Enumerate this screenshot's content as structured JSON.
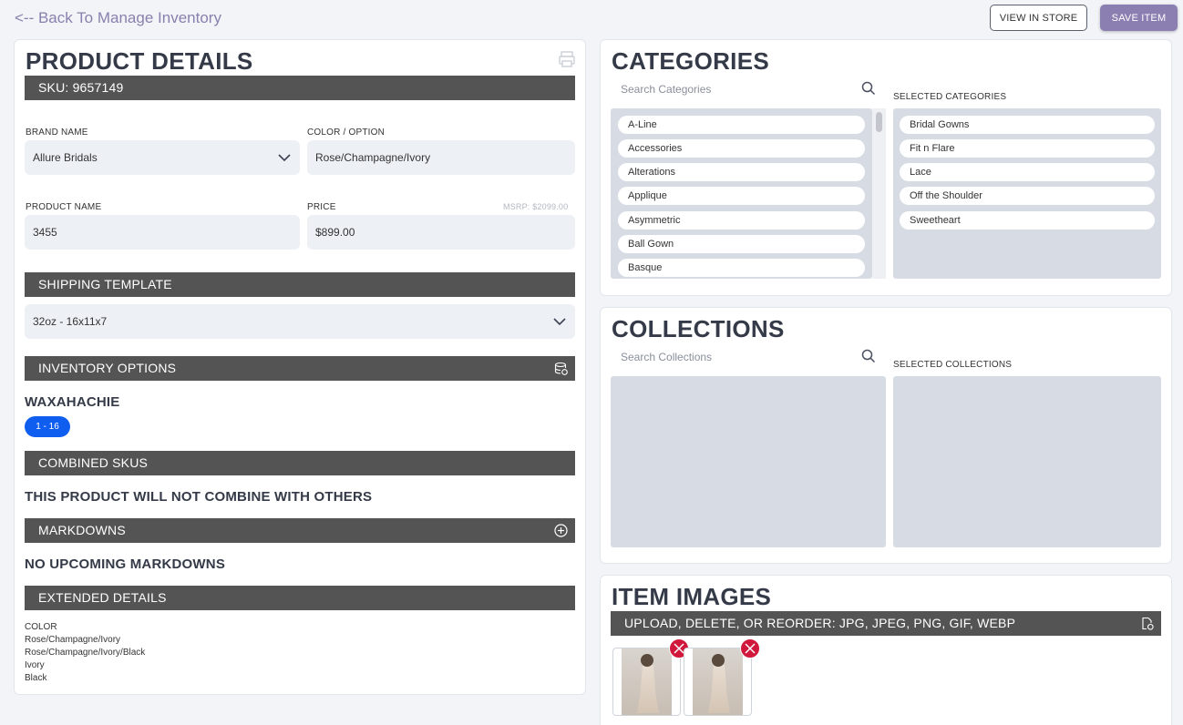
{
  "header": {
    "back_link": "<-- Back To Manage Inventory",
    "view_in_store": "VIEW IN STORE",
    "save_item": "SAVE ITEM"
  },
  "product_details": {
    "title": "PRODUCT DETAILS",
    "sku_bar": "SKU: 9657149",
    "brand_label": "BRAND NAME",
    "brand_value": "Allure Bridals",
    "color_label": "COLOR / OPTION",
    "color_value": "Rose/Champagne/Ivory",
    "product_name_label": "PRODUCT NAME",
    "product_name_value": "3455",
    "price_label": "PRICE",
    "msrp": "MSRP: $2099.00",
    "price_value": "$899.00",
    "shipping_bar": "SHIPPING TEMPLATE",
    "shipping_value": "32oz - 16x11x7",
    "inventory_bar": "INVENTORY OPTIONS",
    "location": "WAXAHACHIE",
    "size_badge": "1 - 16",
    "combined_bar": "COMBINED SKUS",
    "combined_text": "THIS PRODUCT WILL NOT COMBINE WITH OTHERS",
    "markdowns_bar": "MARKDOWNS",
    "markdowns_text": "NO UPCOMING MARKDOWNS",
    "extended_bar": "EXTENDED DETAILS",
    "extended_lines": [
      "COLOR",
      "Rose/Champagne/Ivory",
      "Rose/Champagne/Ivory/Black",
      "Ivory",
      "Black"
    ]
  },
  "categories": {
    "title": "CATEGORIES",
    "search_placeholder": "Search Categories",
    "available": [
      "A-Line",
      "Accessories",
      "Alterations",
      "Applique",
      "Asymmetric",
      "Ball Gown",
      "Basque"
    ],
    "selected_label": "SELECTED CATEGORIES",
    "selected": [
      "Bridal Gowns",
      "Fit n Flare",
      "Lace",
      "Off the Shoulder",
      "Sweetheart"
    ]
  },
  "collections": {
    "title": "COLLECTIONS",
    "search_placeholder": "Search Collections",
    "selected_label": "SELECTED COLLECTIONS"
  },
  "item_images": {
    "title": "ITEM IMAGES",
    "upload_bar": "UPLOAD, DELETE, OR REORDER: JPG, JPEG, PNG, GIF, WEBP"
  },
  "icons": {
    "print": "print-icon",
    "inventory": "database-sync-icon",
    "markdowns": "plus-circle-icon",
    "upload": "file-sync-icon",
    "search": "search-icon",
    "delete": "close-icon"
  }
}
